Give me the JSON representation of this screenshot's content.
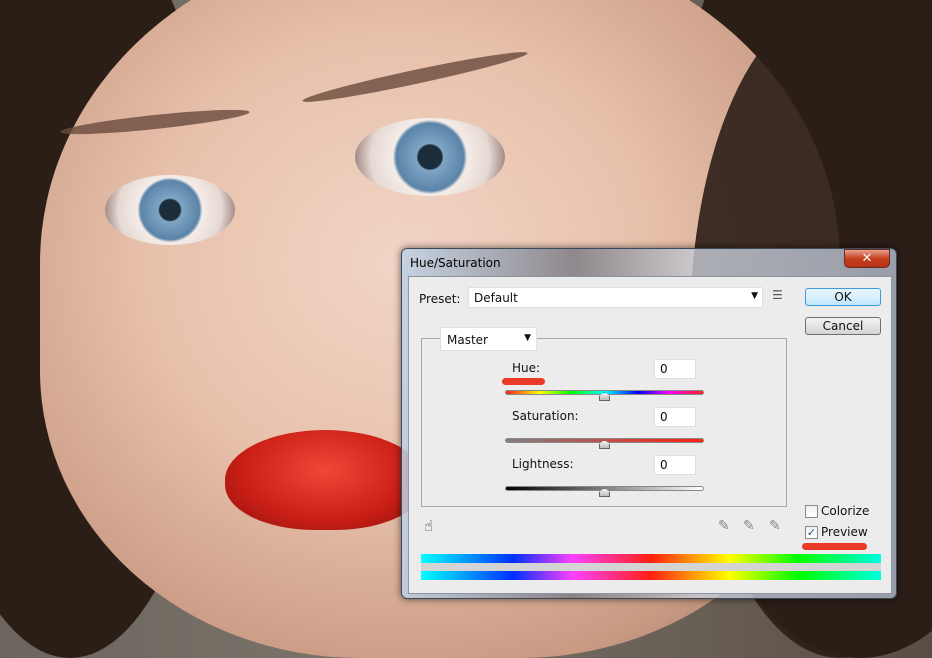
{
  "dialog": {
    "title": "Hue/Saturation",
    "close_label": "✕",
    "preset_label": "Preset:",
    "preset_value": "Default",
    "ok_label": "OK",
    "cancel_label": "Cancel",
    "channel_value": "Master",
    "hue_label": "Hue:",
    "hue_value": "0",
    "saturation_label": "Saturation:",
    "saturation_value": "0",
    "lightness_label": "Lightness:",
    "lightness_value": "0",
    "colorize_label": "Colorize",
    "colorize_checked": false,
    "preview_label": "Preview",
    "preview_checked": true,
    "preview_check": "✓",
    "hue_slider_position": 0.5,
    "saturation_slider_position": 0.5,
    "lightness_slider_position": 0.5
  },
  "colors": {
    "annotation": "#ec3a27",
    "ok_border": "#3c9ce0"
  }
}
